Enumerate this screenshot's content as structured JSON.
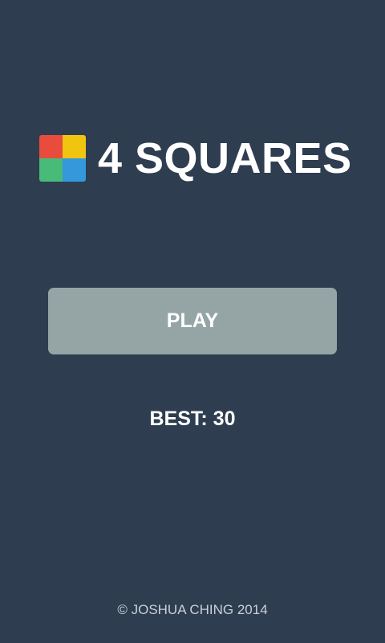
{
  "app": {
    "title": "4 SQUARES",
    "background_color": "#2e3d50"
  },
  "logo": {
    "icon": "four-squares-logo-icon",
    "colors": {
      "top_left": "#e74c3c",
      "top_right": "#f1c40f",
      "bottom_left": "#48bb78",
      "bottom_right": "#3498db"
    }
  },
  "menu": {
    "play_label": "PLAY",
    "play_button_color": "#95a5a6"
  },
  "score": {
    "best_label": "BEST: 30",
    "best_value": 30
  },
  "footer": {
    "copyright": "© JOSHUA CHING 2014"
  }
}
